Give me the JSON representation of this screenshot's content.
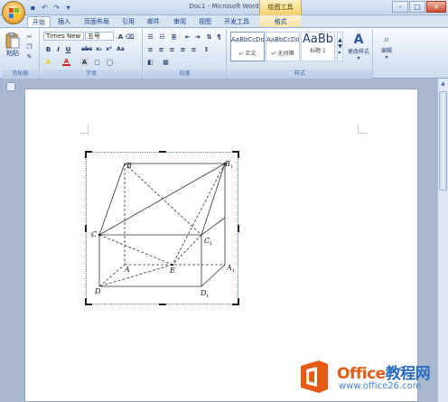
{
  "window": {
    "title": "Doc1 - Microsoft Word",
    "context_tab_group": "绘图工具",
    "controls": {
      "minimize": "–",
      "maximize": "□",
      "close": "×"
    }
  },
  "quick_access": {
    "icons": [
      "save-icon",
      "undo-icon",
      "redo-icon",
      "customize-icon"
    ]
  },
  "tabs": [
    {
      "label": "开始",
      "active": true
    },
    {
      "label": "插入"
    },
    {
      "label": "页面布局"
    },
    {
      "label": "引用"
    },
    {
      "label": "邮件"
    },
    {
      "label": "审阅"
    },
    {
      "label": "视图"
    },
    {
      "label": "开发工具"
    },
    {
      "label": "格式",
      "contextual": true
    }
  ],
  "ribbon": {
    "clipboard": {
      "label": "剪贴板",
      "paste_label": "粘贴"
    },
    "font": {
      "label": "字体",
      "font_name": "Times New R",
      "font_size": "五号",
      "bold": "B",
      "italic": "I",
      "underline": "U",
      "strike": "abc",
      "subscript": "x₂",
      "superscript": "x²",
      "font_color": "A",
      "highlight": "A",
      "char_shading": "A",
      "phonetic": "Aa"
    },
    "paragraph": {
      "label": "段落"
    },
    "styles": {
      "label": "样式",
      "items": [
        {
          "sample": "AaBbCcDd",
          "name": "↵ 正文"
        },
        {
          "sample": "AaBbCcDd",
          "name": "↵ 无间隔"
        },
        {
          "sample": "AaBb",
          "name": "标题 1"
        }
      ],
      "change_styles_label": "更改样式"
    },
    "editing": {
      "label": "编辑"
    }
  },
  "figure": {
    "labels": {
      "B": "B",
      "B1": "B",
      "B1_sub": "1",
      "C": "C",
      "C1": "C",
      "C1_sub": "1",
      "A": "A",
      "E": "E",
      "A1": "A",
      "A1_sub": "1",
      "D": "D",
      "D1": "D",
      "D1_sub": "1"
    }
  },
  "watermark": {
    "brand_main": "Office",
    "brand_cn": "教程网",
    "url": "www.office26.com",
    "accent": "#e55b13",
    "secondary": "#2a6cc4"
  }
}
